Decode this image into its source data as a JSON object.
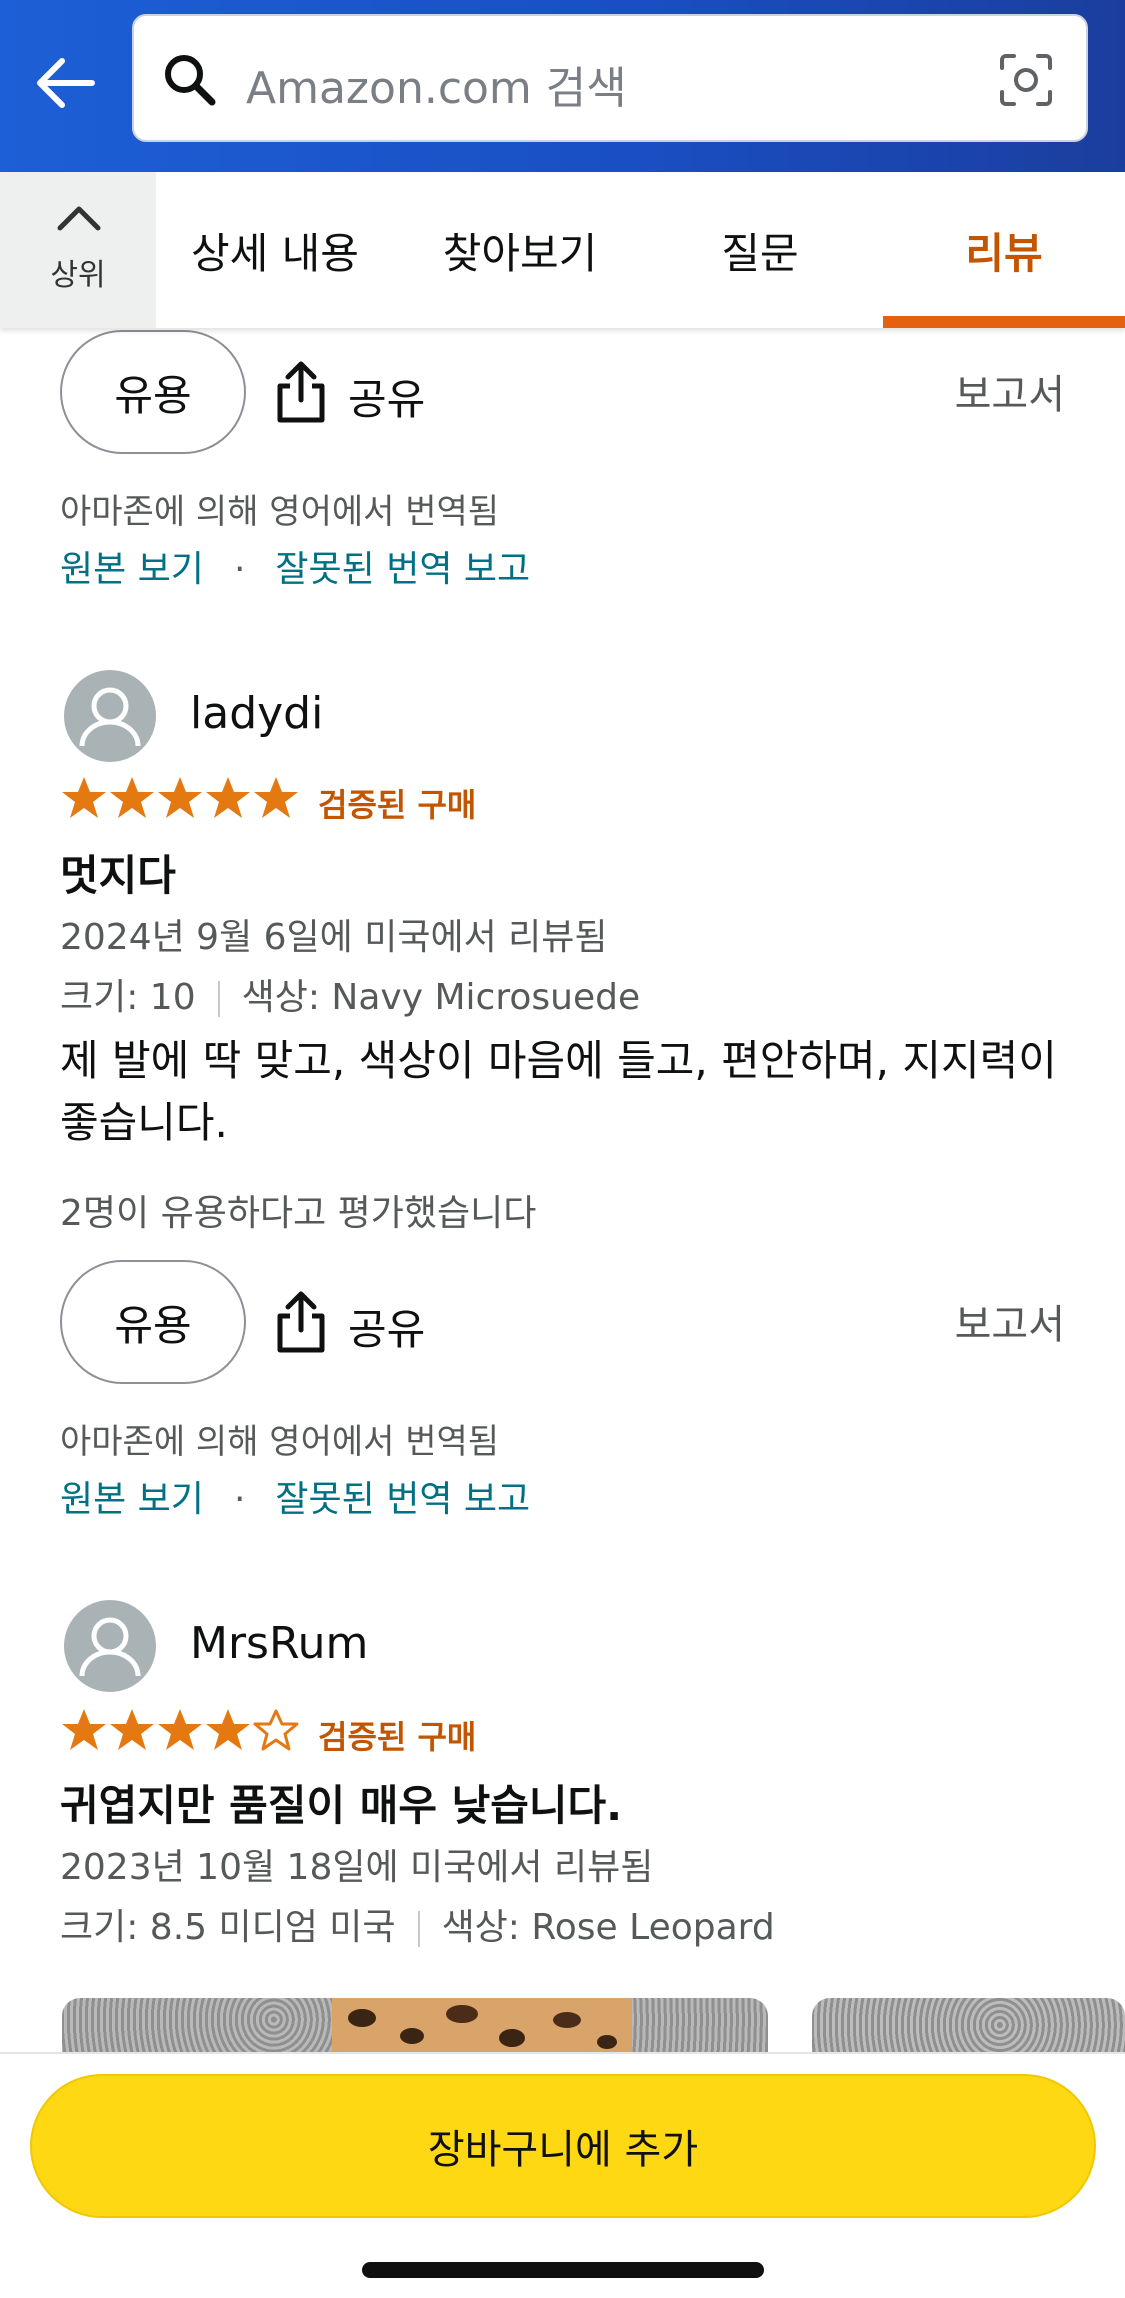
{
  "search": {
    "placeholder": "Amazon.com 검색"
  },
  "tabs": {
    "top_label": "상위",
    "items": [
      "상세 내용",
      "찾아보기",
      "질문",
      "리뷰"
    ],
    "active_index": 3
  },
  "colors": {
    "header": "#1a4fc4",
    "accent": "#c45500",
    "link": "#007185",
    "cart_button": "#ffd814",
    "star": "#e47911"
  },
  "prev_review": {
    "helpful_label": "유용",
    "share_label": "공유",
    "report_label": "보고서",
    "translated_note": "아마존에 의해 영어에서 번역됨",
    "view_original": "원본 보기",
    "dot": "·",
    "report_translation": "잘못된 번역 보고"
  },
  "reviews": [
    {
      "name": "ladydi",
      "rating": 5,
      "verified": "검증된 구매",
      "title": "멋지다",
      "date": "2024년 9월 6일에 미국에서 리뷰됨",
      "size": "크기: 10",
      "color": "색상: Navy Microsuede",
      "body": "제 발에 딱 맞고, 색상이 마음에 들고, 편안하며, 지지력이 좋습니다.",
      "helpful_count": "2명이 유용하다고 평가했습니다",
      "helpful_label": "유용",
      "share_label": "공유",
      "report_label": "보고서",
      "translated_note": "아마존에 의해 영어에서 번역됨",
      "view_original": "원본 보기",
      "dot": "·",
      "report_translation": "잘못된 번역 보고"
    },
    {
      "name": "MrsRum",
      "rating": 4,
      "verified": "검증된 구매",
      "title": "귀엽지만 품질이 매우 낮습니다.",
      "date": "2023년 10월 18일에 미국에서 리뷰됨",
      "size": "크기: 8.5 미디엄 미국",
      "color": "색상: Rose Leopard"
    }
  ],
  "cart_button": "장바구니에 추가"
}
